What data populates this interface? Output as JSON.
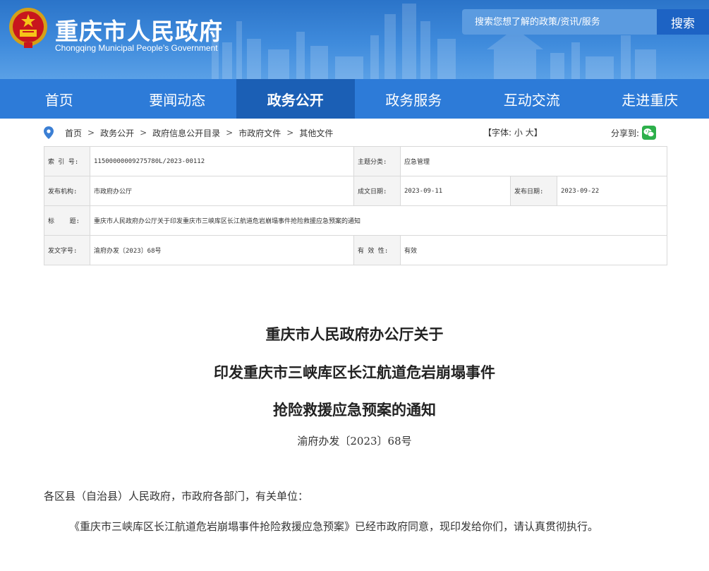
{
  "header": {
    "site_title": "重庆市人民政府",
    "site_subtitle": "Chongqing Municipal People’s Government",
    "search_placeholder": "搜索您想了解的政策/资讯/服务",
    "search_button": "搜索"
  },
  "nav": {
    "items": [
      {
        "label": "首页"
      },
      {
        "label": "要闻动态"
      },
      {
        "label": "政务公开"
      },
      {
        "label": "政务服务"
      },
      {
        "label": "互动交流"
      },
      {
        "label": "走进重庆"
      }
    ],
    "active": "政务公开"
  },
  "breadcrumb": {
    "items": [
      "首页",
      "政务公开",
      "政府信息公开目录",
      "市政府文件",
      "其他文件"
    ],
    "separator": ">"
  },
  "font_size": {
    "open": "【字体:",
    "small": "小",
    "large": "大",
    "close": "】"
  },
  "share": {
    "label": "分享到:"
  },
  "meta": {
    "index_label": "索 引 号:",
    "index_value": "11500000009275780L/2023-00112",
    "topic_label": "主题分类:",
    "topic_value": "应急管理",
    "issuer_label": "发布机构:",
    "issuer_value": "市政府办公厅",
    "written_label": "成文日期:",
    "written_value": "2023-09-11",
    "published_label": "发布日期:",
    "published_value": "2023-09-22",
    "title_label": "标    题:",
    "title_value": "重庆市人民政府办公厅关于印发重庆市三峡库区长江航道危岩崩塌事件抢险救援应急预案的通知",
    "doc_no_label": "发文字号:",
    "doc_no_value": "渝府办发〔2023〕68号",
    "validity_label": "有 效 性:",
    "validity_value": "有效"
  },
  "document": {
    "title_lines": [
      "重庆市人民政府办公厅关于",
      "印发重庆市三峡库区长江航道危岩崩塌事件",
      "抢险救援应急预案的通知"
    ],
    "doc_number": "渝府办发〔2023〕68号",
    "salutation": "各区县（自治县）人民政府，市政府各部门，有关单位：",
    "body": "《重庆市三峡库区长江航道危岩崩塌事件抢险救援应急预案》已经市政府同意，现印发给你们，请认真贯彻执行。"
  },
  "colors": {
    "header_blue": "#3f8bdc",
    "nav_blue": "#2d7bd8",
    "nav_active": "#1b5fb5",
    "search_button": "#1d63c4",
    "wechat_green": "#2db04b"
  }
}
